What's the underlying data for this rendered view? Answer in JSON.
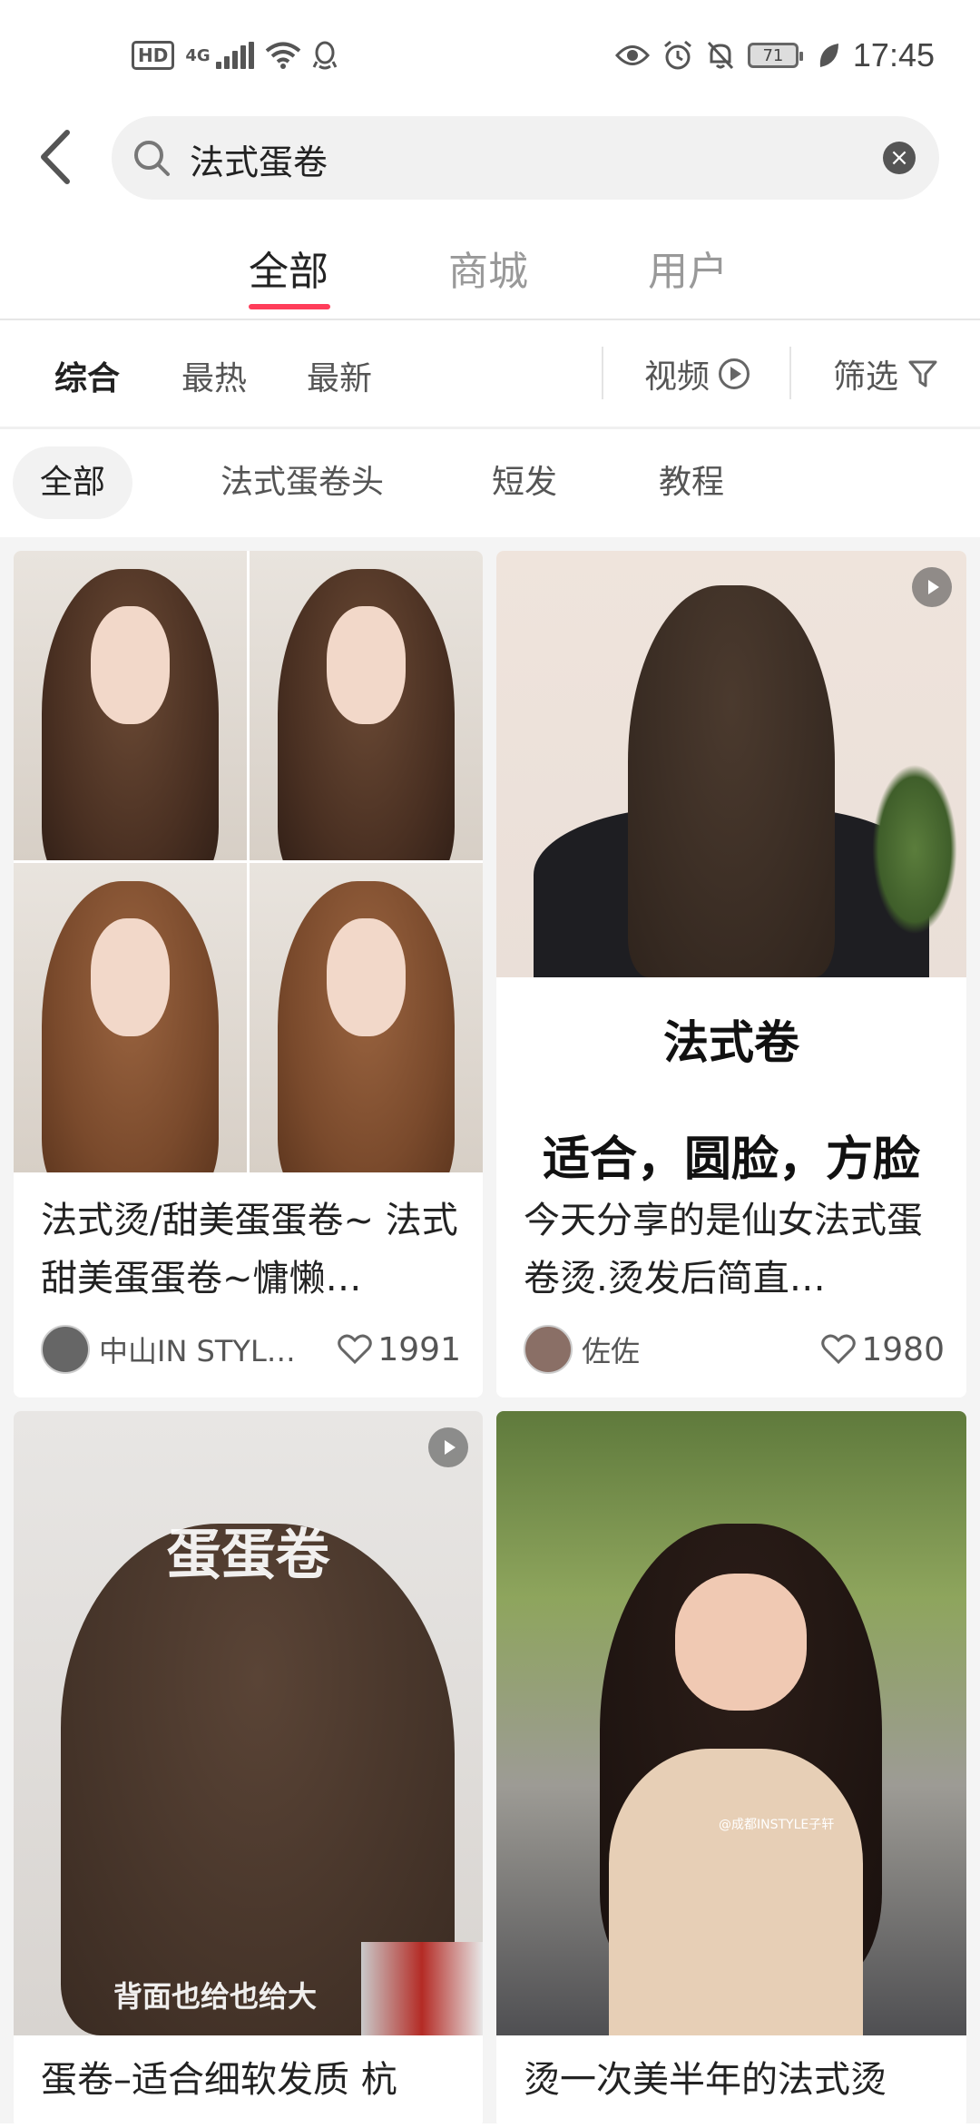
{
  "status_bar": {
    "hd": "HD",
    "network": "4G",
    "battery": "71",
    "time": "17:45"
  },
  "search": {
    "query": "法式蛋卷"
  },
  "main_tabs": [
    {
      "label": "全部",
      "active": true
    },
    {
      "label": "商城",
      "active": false
    },
    {
      "label": "用户",
      "active": false
    }
  ],
  "sort": {
    "items": [
      "综合",
      "最热",
      "最新"
    ],
    "video_label": "视频",
    "filter_label": "筛选"
  },
  "chips": [
    "全部",
    "法式蛋卷头",
    "短发",
    "教程"
  ],
  "cards": [
    {
      "title": "法式烫/甜美蛋蛋卷~ 法式甜美蛋蛋卷~慵懒…",
      "author": "中山IN STYLE…",
      "likes": "1991",
      "is_video": false
    },
    {
      "image_text_1": "法式卷",
      "image_text_2": "适合，圆脸，方脸",
      "title": "今天分享的是仙女法式蛋卷烫.烫发后简直…",
      "author": "佐佐",
      "likes": "1980",
      "is_video": true
    },
    {
      "image_text_top": "蛋蛋卷",
      "image_text_bottom": "背面也给也给大",
      "title": "蛋卷–适合细软发质 杭",
      "is_video": true
    },
    {
      "watermark": "@成都INSTYLE子轩",
      "title": "烫一次美半年的法式烫",
      "is_video": false
    }
  ],
  "colors": {
    "accent": "#ff3d5a"
  }
}
